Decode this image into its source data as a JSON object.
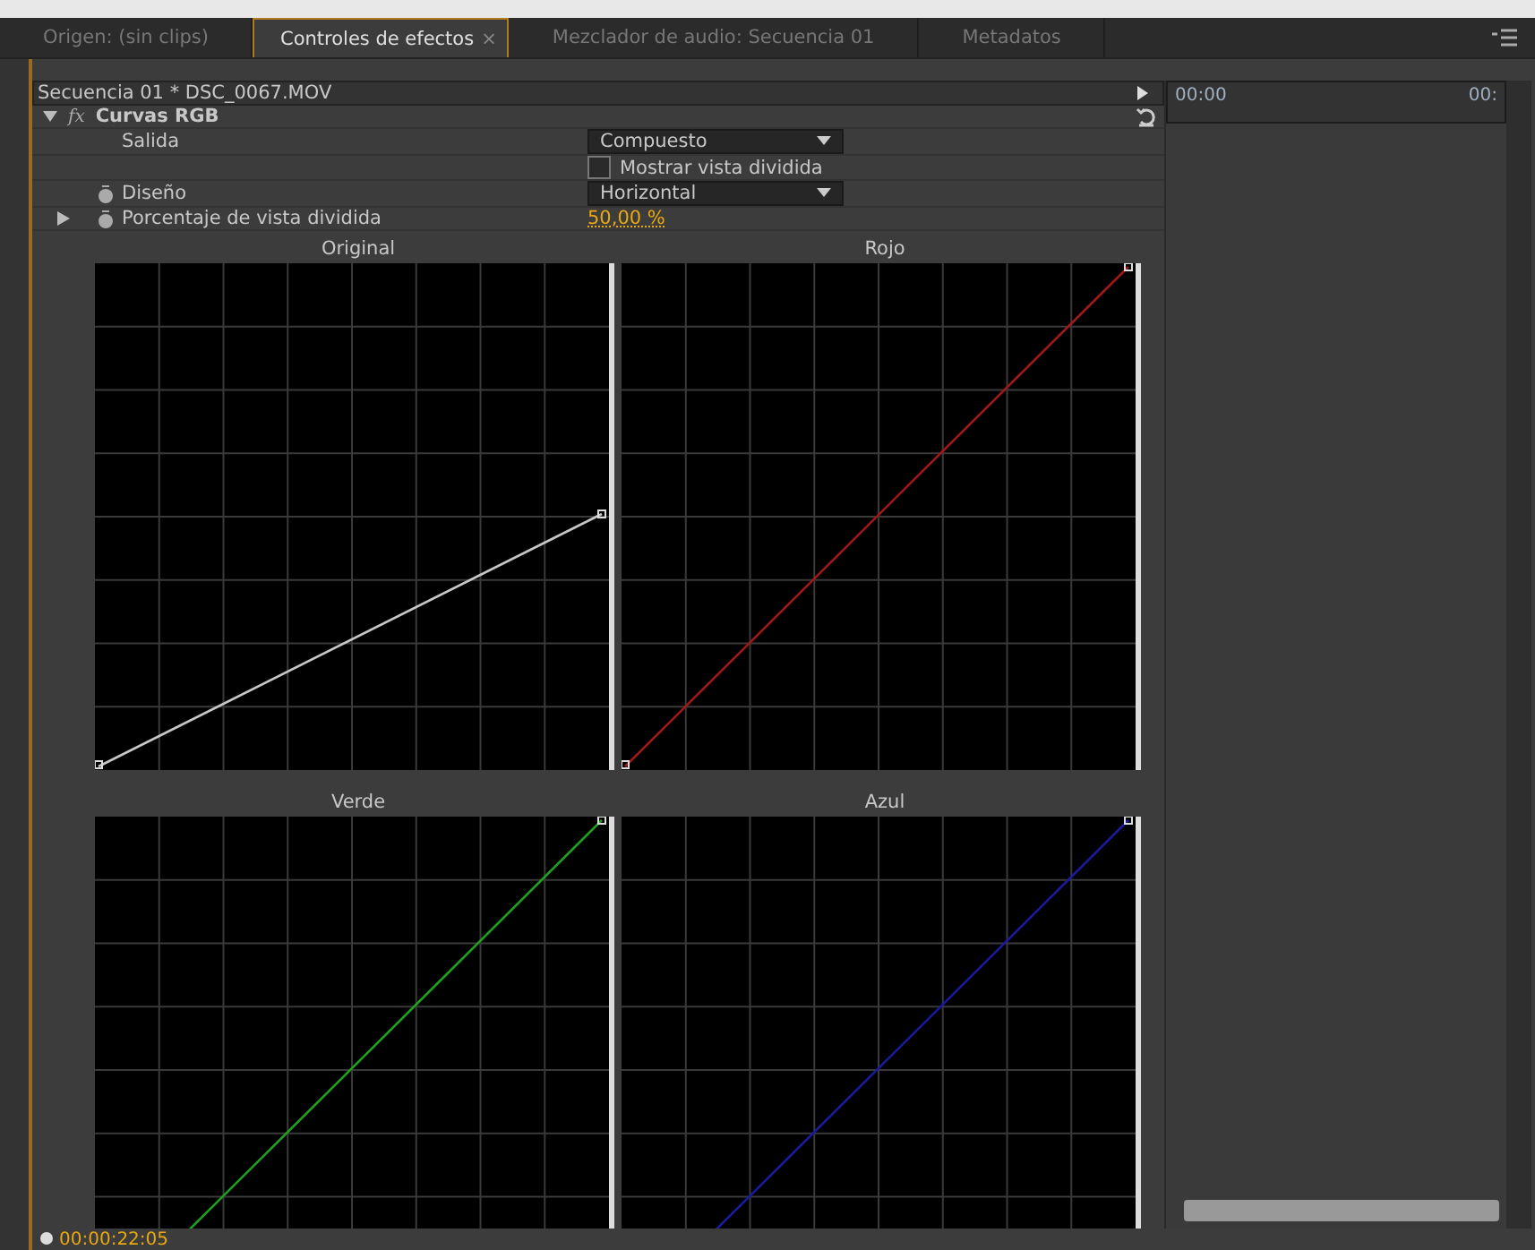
{
  "tabs": [
    {
      "label": "Origen: (sin clips)",
      "selected": false,
      "closable": false
    },
    {
      "label": "Controles de efectos",
      "selected": true,
      "closable": true,
      "close": "×"
    },
    {
      "label": "Mezclador de audio: Secuencia 01",
      "selected": false,
      "closable": false
    },
    {
      "label": "Metadatos",
      "selected": false,
      "closable": false
    }
  ],
  "clip_header": {
    "title": "Secuencia 01 * DSC_0067.MOV"
  },
  "timeline": {
    "start": "00:00",
    "end": "00:"
  },
  "effect": {
    "name": "Curvas RGB",
    "expanded": true,
    "fx": "fx"
  },
  "properties": [
    {
      "kind": "dropdown",
      "label": "Salida",
      "value": "Compuesto",
      "stopwatch": false,
      "expandable": false
    },
    {
      "kind": "checkbox",
      "label": "Mostrar vista dividida",
      "checked": false,
      "stopwatch": false,
      "expandable": false
    },
    {
      "kind": "dropdown",
      "label": "Diseño",
      "value": "Horizontal",
      "stopwatch": true,
      "expandable": false
    },
    {
      "kind": "value",
      "label": "Porcentaje de vista dividida",
      "value": "50,00 %",
      "stopwatch": true,
      "expandable": true
    }
  ],
  "curves": [
    {
      "title": "Original",
      "kind": "composite",
      "color": "#c8c8c8"
    },
    {
      "title": "Rojo",
      "kind": "channel",
      "color": "#a01818"
    },
    {
      "title": "Verde",
      "kind": "channel",
      "color": "#1fa01f"
    },
    {
      "title": "Azul",
      "kind": "channel",
      "color": "#1a1aa0"
    }
  ],
  "status": {
    "timecode": "00:00:22:05"
  }
}
